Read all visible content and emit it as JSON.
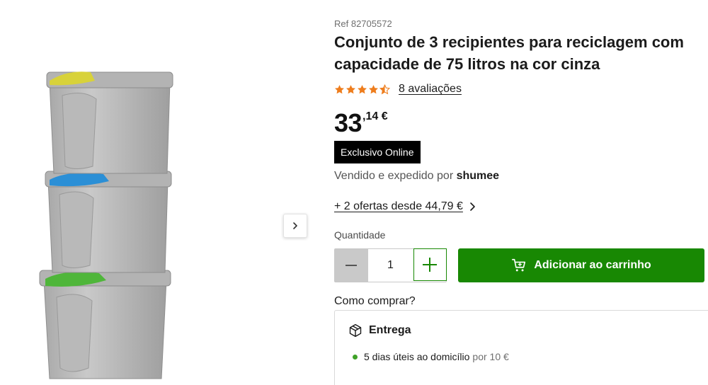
{
  "product": {
    "ref": "Ref 82705572",
    "title": "Conjunto de 3 recipientes para reciclagem com capacidade de 75 litros na cor cinza",
    "rating": {
      "value": 4.5,
      "max": 5,
      "reviews_label": "8 avaliações"
    },
    "price": {
      "integer": "33",
      "decimal": ",14 €"
    },
    "badge": "Exclusivo Online",
    "seller": {
      "prefix": "Vendido e expedido por",
      "name": "shumee"
    },
    "offers_label": "+ 2 ofertas desde 44,79 €",
    "image_alt": "stacked-grey-recycling-bins"
  },
  "purchase": {
    "quantity_label": "Quantidade",
    "quantity_value": "1",
    "add_to_cart_label": "Adicionar ao carrinho"
  },
  "delivery": {
    "how_to_buy": "Como comprar?",
    "title": "Entrega",
    "option": "5 dias úteis ao domicílio",
    "option_price": "por 10 €"
  },
  "colors": {
    "accent_green": "#188803",
    "star_orange": "#ee7d1d",
    "badge_black": "#000000",
    "lid_yellow": "#d8d23a",
    "lid_blue": "#2b8fd6",
    "lid_green": "#4fb63a"
  },
  "icons": [
    "chevron-right-icon",
    "star-icon",
    "minus-icon",
    "plus-icon",
    "cart-icon",
    "package-icon"
  ]
}
